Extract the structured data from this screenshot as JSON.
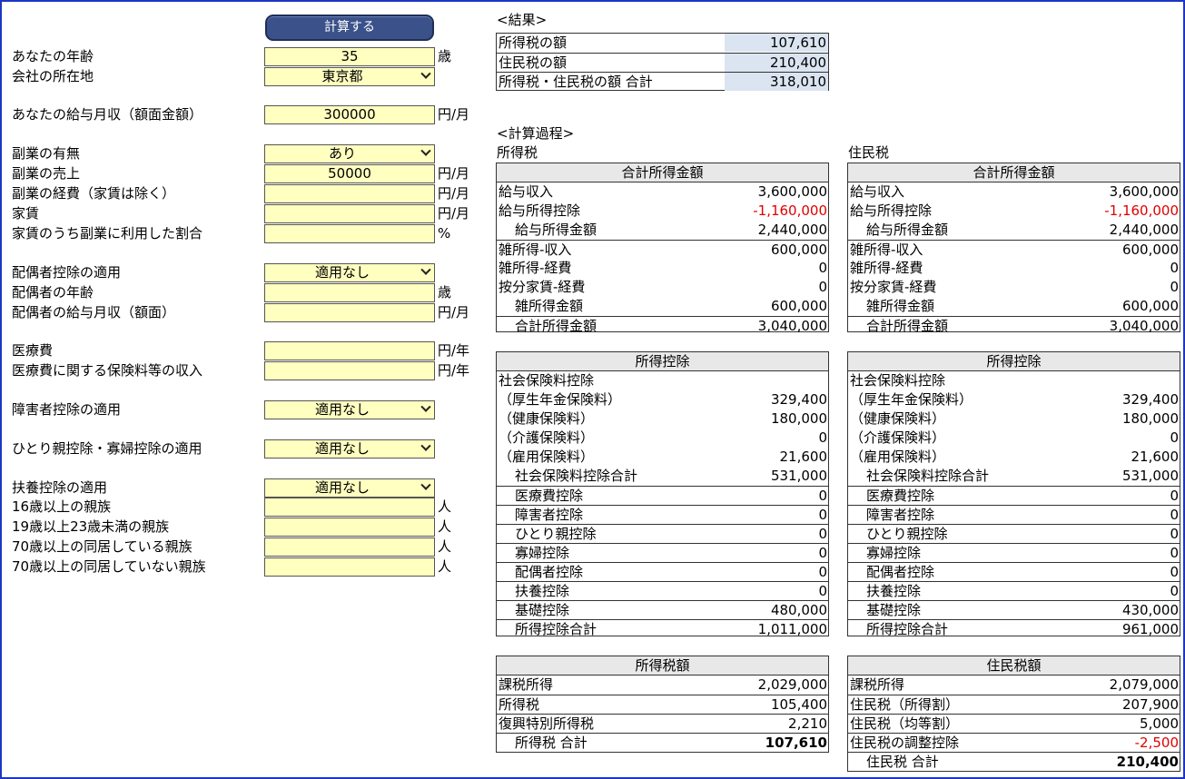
{
  "calc_button": "計算する",
  "form": {
    "age_label": "あなたの年齢",
    "age_value": "35",
    "age_unit": "歳",
    "location_label": "会社の所在地",
    "location_value": "東京都",
    "salary_label": "あなたの給与月収（額面金額）",
    "salary_value": "300000",
    "salary_unit": "円/月",
    "side_label": "副業の有無",
    "side_value": "あり",
    "side_sales_label": "副業の売上",
    "side_sales_value": "50000",
    "side_sales_unit": "円/月",
    "side_exp_label": "副業の経費（家賃は除く）",
    "side_exp_value": "",
    "side_exp_unit": "円/月",
    "rent_label": "家賃",
    "rent_value": "",
    "rent_unit": "円/月",
    "rent_ratio_label": "家賃のうち副業に利用した割合",
    "rent_ratio_value": "",
    "rent_ratio_unit": "%",
    "spouse_label": "配偶者控除の適用",
    "spouse_value": "適用なし",
    "spouse_age_label": "配偶者の年齢",
    "spouse_age_value": "",
    "spouse_age_unit": "歳",
    "spouse_salary_label": "配偶者の給与月収（額面）",
    "spouse_salary_value": "",
    "spouse_salary_unit": "円/月",
    "medical_label": "医療費",
    "medical_value": "",
    "medical_unit": "円/年",
    "medical_ins_label": "医療費に関する保険料等の収入",
    "medical_ins_value": "",
    "medical_ins_unit": "円/年",
    "disability_label": "障害者控除の適用",
    "disability_value": "適用なし",
    "single_parent_label": "ひとり親控除・寡婦控除の適用",
    "single_parent_value": "適用なし",
    "dependent_label": "扶養控除の適用",
    "dependent_value": "適用なし",
    "dep16_label": "16歳以上の親族",
    "dep16_value": "",
    "dep16_unit": "人",
    "dep19_label": "19歳以上23歳未満の親族",
    "dep19_value": "",
    "dep19_unit": "人",
    "dep70a_label": "70歳以上の同居している親族",
    "dep70a_value": "",
    "dep70a_unit": "人",
    "dep70b_label": "70歳以上の同居していない親族",
    "dep70b_value": "",
    "dep70b_unit": "人"
  },
  "result": {
    "title": "<結果>",
    "rows": [
      {
        "label": "所得税の額",
        "value": "107,610"
      },
      {
        "label": "住民税の額",
        "value": "210,400"
      },
      {
        "label": "所得税・住民税の額 合計",
        "value": "318,010"
      }
    ]
  },
  "process": {
    "title": "<計算過程>",
    "income_tax_title": "所得税",
    "resident_tax_title": "住民税"
  },
  "income": {
    "header": "合計所得金額",
    "left": [
      {
        "k": "給与収入",
        "v": "3,600,000"
      },
      {
        "k": "給与所得控除",
        "v": "-1,160,000",
        "neg": true
      },
      {
        "k": "給与所得金額",
        "v": "2,440,000",
        "ind": true
      },
      {
        "k": "雑所得-収入",
        "v": "600,000",
        "line": true
      },
      {
        "k": "雑所得-経費",
        "v": "0"
      },
      {
        "k": "按分家賃-経費",
        "v": "0"
      },
      {
        "k": "雑所得金額",
        "v": "600,000",
        "ind": true
      },
      {
        "k": "合計所得金額",
        "v": "3,040,000",
        "ind": true,
        "line": true
      }
    ],
    "right": [
      {
        "k": "給与収入",
        "v": "3,600,000"
      },
      {
        "k": "給与所得控除",
        "v": "-1,160,000",
        "neg": true
      },
      {
        "k": "給与所得金額",
        "v": "2,440,000",
        "ind": true
      },
      {
        "k": "雑所得-収入",
        "v": "600,000",
        "line": true
      },
      {
        "k": "雑所得-経費",
        "v": "0"
      },
      {
        "k": "按分家賃-経費",
        "v": "0"
      },
      {
        "k": "雑所得金額",
        "v": "600,000",
        "ind": true
      },
      {
        "k": "合計所得金額",
        "v": "3,040,000",
        "ind": true,
        "line": true
      }
    ]
  },
  "deduction": {
    "header": "所得控除",
    "left": [
      {
        "k": "社会保険料控除",
        "v": ""
      },
      {
        "k": "（厚生年金保険料）",
        "v": "329,400"
      },
      {
        "k": "（健康保険料）",
        "v": "180,000"
      },
      {
        "k": "（介護保険料）",
        "v": "0"
      },
      {
        "k": "（雇用保険料）",
        "v": "21,600"
      },
      {
        "k": "社会保険料控除合計",
        "v": "531,000",
        "ind": true
      },
      {
        "k": "医療費控除",
        "v": "0",
        "ind": true,
        "line": true
      },
      {
        "k": "障害者控除",
        "v": "0",
        "ind": true,
        "line": true
      },
      {
        "k": "ひとり親控除",
        "v": "0",
        "ind": true,
        "line": true
      },
      {
        "k": "寡婦控除",
        "v": "0",
        "ind": true,
        "line": true
      },
      {
        "k": "配偶者控除",
        "v": "0",
        "ind": true,
        "line": true
      },
      {
        "k": "扶養控除",
        "v": "0",
        "ind": true,
        "line": true
      },
      {
        "k": "基礎控除",
        "v": "480,000",
        "ind": true,
        "line": true
      },
      {
        "k": "所得控除合計",
        "v": "1,011,000",
        "ind": true,
        "line": true
      }
    ],
    "right": [
      {
        "k": "社会保険料控除",
        "v": ""
      },
      {
        "k": "（厚生年金保険料）",
        "v": "329,400"
      },
      {
        "k": "（健康保険料）",
        "v": "180,000"
      },
      {
        "k": "（介護保険料）",
        "v": "0"
      },
      {
        "k": "（雇用保険料）",
        "v": "21,600"
      },
      {
        "k": "社会保険料控除合計",
        "v": "531,000",
        "ind": true
      },
      {
        "k": "医療費控除",
        "v": "0",
        "ind": true,
        "line": true
      },
      {
        "k": "障害者控除",
        "v": "0",
        "ind": true,
        "line": true
      },
      {
        "k": "ひとり親控除",
        "v": "0",
        "ind": true,
        "line": true
      },
      {
        "k": "寡婦控除",
        "v": "0",
        "ind": true,
        "line": true
      },
      {
        "k": "配偶者控除",
        "v": "0",
        "ind": true,
        "line": true
      },
      {
        "k": "扶養控除",
        "v": "0",
        "ind": true,
        "line": true
      },
      {
        "k": "基礎控除",
        "v": "430,000",
        "ind": true,
        "line": true
      },
      {
        "k": "所得控除合計",
        "v": "961,000",
        "ind": true,
        "line": true
      }
    ]
  },
  "tax": {
    "left_header": "所得税額",
    "right_header": "住民税額",
    "left": [
      {
        "k": "課税所得",
        "v": "2,029,000"
      },
      {
        "k": "所得税",
        "v": "105,400",
        "line": true
      },
      {
        "k": "復興特別所得税",
        "v": "2,210",
        "line": true
      },
      {
        "k": "所得税 合計",
        "v": "107,610",
        "ind": true,
        "line": true,
        "bold": true
      }
    ],
    "right": [
      {
        "k": "課税所得",
        "v": "2,079,000"
      },
      {
        "k": "住民税（所得割）",
        "v": "207,900",
        "line": true
      },
      {
        "k": "住民税（均等割）",
        "v": "5,000",
        "line": true
      },
      {
        "k": "住民税の調整控除",
        "v": "-2,500",
        "line": true,
        "neg": true
      },
      {
        "k": "住民税 合計",
        "v": "210,400",
        "ind": true,
        "line": true,
        "bold": true
      }
    ]
  },
  "colors": {
    "frame": "#1d35c4",
    "input_bg": "#ffffc0",
    "button_bg": "#3a5189",
    "result_bg": "#dbe5f1",
    "negative": "#e00000",
    "header_bg": "#e8e8e8"
  }
}
